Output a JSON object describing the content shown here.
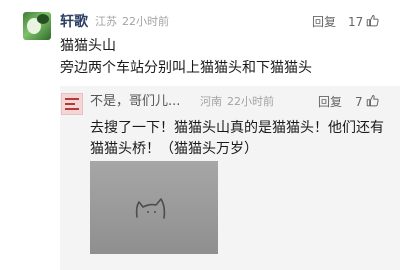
{
  "comment": {
    "username": "轩歌",
    "location": "江苏",
    "time": "22小时前",
    "reply_label": "回复",
    "likes": "17",
    "text_lines": [
      "猫猫头山",
      "旁边两个车站分别叫上猫猫头和下猫猫头"
    ]
  },
  "reply": {
    "username": "不是，哥们儿...",
    "location": "河南",
    "time": "22小时前",
    "reply_label": "回复",
    "likes": "7",
    "text": "去搜了一下！猫猫头山真的是猫猫头！他们还有猫猫头桥！（猫猫头万岁）"
  },
  "icons": {
    "like": "thumbs-up-icon"
  },
  "colors": {
    "username": "#2c3e63",
    "meta": "#a3a3a3",
    "reply_background": "#f4f4f4"
  }
}
